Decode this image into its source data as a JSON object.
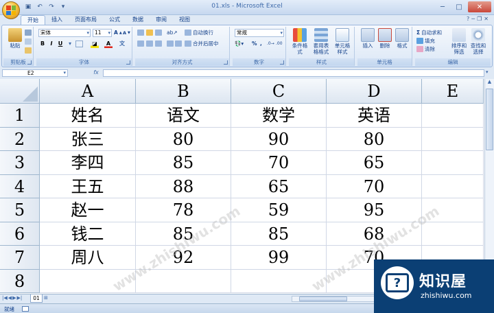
{
  "window": {
    "title": "01.xls - Microsoft Excel"
  },
  "ribbon_tabs": [
    "开始",
    "插入",
    "页面布局",
    "公式",
    "数据",
    "审阅",
    "视图"
  ],
  "ribbon": {
    "clipboard": {
      "paste_label": "粘贴",
      "group_label": "剪贴板"
    },
    "font": {
      "font_name": "宋体",
      "font_size": "11",
      "bold": "B",
      "italic": "I",
      "underline": "U",
      "group_label": "字体"
    },
    "alignment": {
      "wrap_text": "自动换行",
      "merge_center": "合并后居中",
      "group_label": "对齐方式"
    },
    "number": {
      "format": "常规",
      "group_label": "数字"
    },
    "styles": {
      "conditional_format": "条件格式",
      "format_as_table": "套用表格格式",
      "cell_styles": "单元格样式",
      "group_label": "样式"
    },
    "cells": {
      "insert": "插入",
      "delete": "删除",
      "format": "格式",
      "group_label": "单元格"
    },
    "editing": {
      "autosum": "自动求和",
      "fill": "填充",
      "clear": "清除",
      "sort_filter": "排序和筛选",
      "find_select": "查找和选择",
      "group_label": "编辑"
    }
  },
  "formula_bar": {
    "name_box": "E2",
    "fx": "fx",
    "formula": ""
  },
  "columns": [
    "A",
    "B",
    "C",
    "D",
    "E"
  ],
  "rows": [
    "1",
    "2",
    "3",
    "4",
    "5",
    "6",
    "7",
    "8"
  ],
  "table": [
    [
      "姓名",
      "语文",
      "数学",
      "英语",
      ""
    ],
    [
      "张三",
      "80",
      "90",
      "80",
      ""
    ],
    [
      "李四",
      "85",
      "70",
      "65",
      ""
    ],
    [
      "王五",
      "88",
      "65",
      "70",
      ""
    ],
    [
      "赵一",
      "78",
      "59",
      "95",
      ""
    ],
    [
      "钱二",
      "85",
      "85",
      "68",
      ""
    ],
    [
      "周八",
      "92",
      "99",
      "70",
      ""
    ],
    [
      "",
      "",
      "",
      "",
      ""
    ]
  ],
  "sheets": [
    "01"
  ],
  "status": {
    "ready": "就绪"
  },
  "watermark": {
    "text": "www.zhishiwu.com",
    "brand_name": "知识屋",
    "brand_url": "zhishiwu.com"
  },
  "colors": {
    "ribbon_bg": "#dbe7f6",
    "header_bg": "#dde6f1",
    "grid_line": "#d0d7e5",
    "brand_bg": "#0b3f74"
  }
}
